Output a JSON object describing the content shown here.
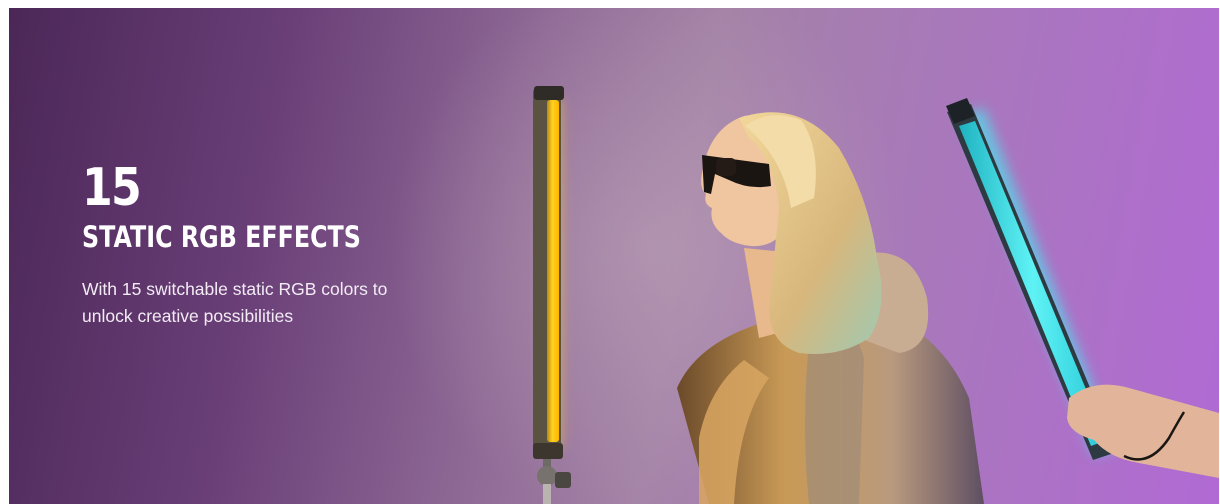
{
  "feature": {
    "number": "15",
    "title": "STATIC RGB EFFECTS",
    "description": "With 15 switchable static RGB colors to unlock creative possibilities"
  },
  "colors": {
    "background_left": "#4b2757",
    "background_right": "#b16ad4",
    "tube_yellow": "#ffc21a",
    "tube_cyan": "#39e7ef",
    "text": "#ffffff"
  },
  "illustration": {
    "left_light": "yellow-rgb-tube-light-icon",
    "person": "woman-in-sunglasses-profile",
    "right_light": "cyan-rgb-tube-light-icon"
  }
}
